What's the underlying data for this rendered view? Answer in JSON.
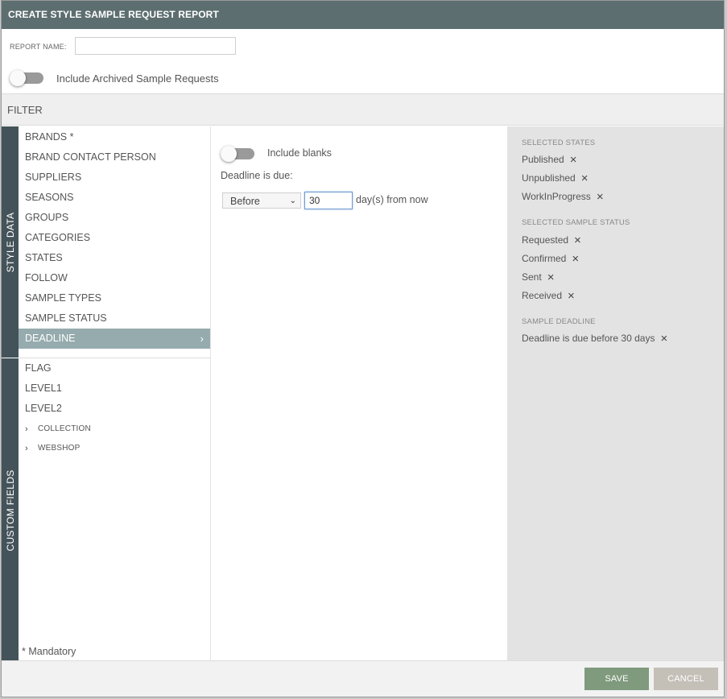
{
  "dialog": {
    "title": "CREATE STYLE SAMPLE REQUEST REPORT"
  },
  "report_name": {
    "label": "REPORT NAME:",
    "value": "",
    "placeholder": ""
  },
  "archived": {
    "label": "Include Archived Sample Requests",
    "enabled": false
  },
  "filter": {
    "label": "FILTER"
  },
  "tabs": {
    "style_data": "STYLE DATA",
    "custom_fields": "CUSTOM FIELDS"
  },
  "style_data_items": [
    {
      "label": "BRANDS *"
    },
    {
      "label": "BRAND CONTACT PERSON"
    },
    {
      "label": "SUPPLIERS"
    },
    {
      "label": "SEASONS"
    },
    {
      "label": "GROUPS"
    },
    {
      "label": "CATEGORIES"
    },
    {
      "label": "STATES"
    },
    {
      "label": "FOLLOW"
    },
    {
      "label": "SAMPLE TYPES"
    },
    {
      "label": "SAMPLE STATUS"
    },
    {
      "label": "DEADLINE",
      "active": true
    }
  ],
  "custom_field_items": [
    {
      "label": "FLAG"
    },
    {
      "label": "LEVEL1"
    },
    {
      "label": "LEVEL2"
    }
  ],
  "custom_field_groups": [
    {
      "label": "COLLECTION"
    },
    {
      "label": "WEBSHOP"
    }
  ],
  "mandatory_note": "* Mandatory",
  "deadline": {
    "include_blanks_label": "Include blanks",
    "include_blanks_enabled": false,
    "due_label": "Deadline is due:",
    "selected_option": "Before",
    "days_value": "30",
    "suffix": "day(s) from now"
  },
  "summary": {
    "states_heading": "SELECTED STATES",
    "states": [
      "Published",
      "Unpublished",
      "WorkInProgress"
    ],
    "status_heading": "SELECTED SAMPLE STATUS",
    "statuses": [
      "Requested",
      "Confirmed",
      "Sent",
      "Received"
    ],
    "deadline_heading": "SAMPLE DEADLINE",
    "deadline_text": "Deadline is due before 30 days"
  },
  "buttons": {
    "save": "SAVE",
    "cancel": "CANCEL"
  },
  "colors": {
    "header": "#5d6e70",
    "tab": "#44535a",
    "active_item": "#96abad",
    "save": "#7f9a7d",
    "cancel": "#c4bfb7"
  }
}
